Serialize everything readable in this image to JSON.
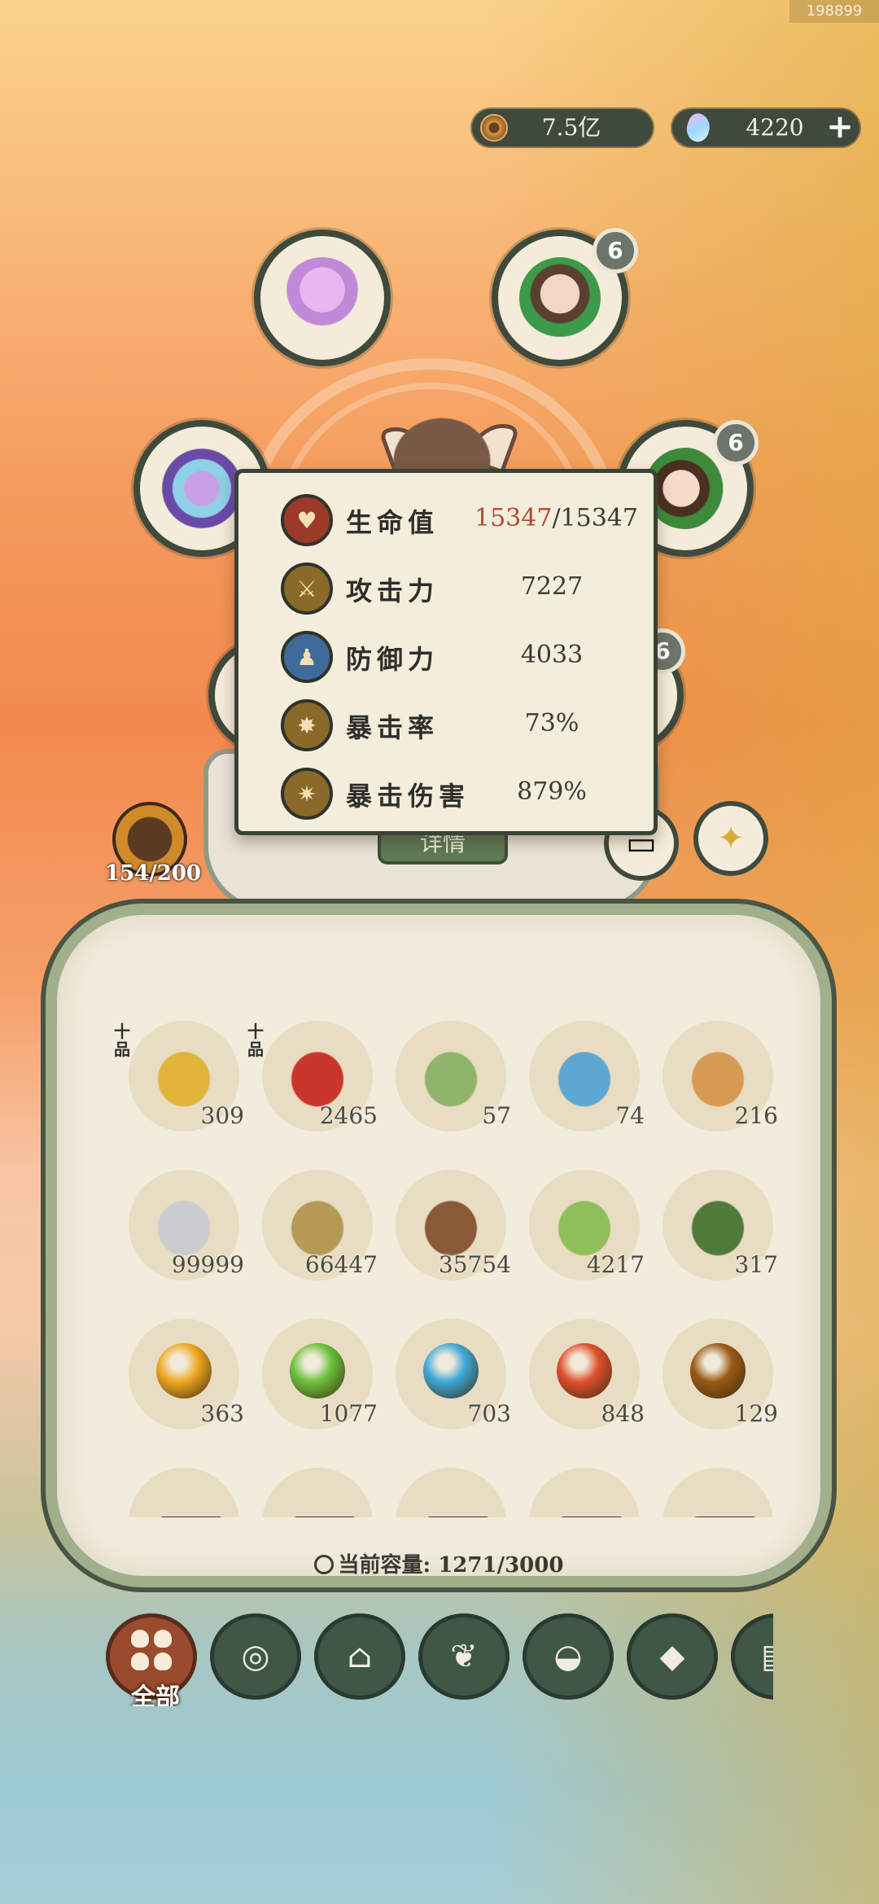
{
  "watermark": "198899",
  "currency": {
    "coin": {
      "icon": "copper-coin-icon",
      "value": "7.5亿"
    },
    "gem": {
      "icon": "crystal-gem-icon",
      "value": "4220",
      "plus": "+"
    }
  },
  "equipment_badges": {
    "top_right": "6",
    "mid_right": "6",
    "lower_right": "6"
  },
  "stats": [
    {
      "icon": "heart-icon",
      "name": "生命值",
      "current": "15347",
      "max": "/15347",
      "color": "#9c3a2a"
    },
    {
      "icon": "sword-icon",
      "name": "攻击力",
      "value": "7227",
      "color": "#8a6a2a"
    },
    {
      "icon": "shield-figure-icon",
      "name": "防御力",
      "value": "4033",
      "color": "#3f6b9a"
    },
    {
      "icon": "crit-burst-icon",
      "name": "暴击率",
      "value": "73%",
      "color": "#8a6a2a"
    },
    {
      "icon": "crit-damage-icon",
      "name": "暴击伤害",
      "value": "879%",
      "color": "#8a6a2a"
    }
  ],
  "detail_button": "详情",
  "side_count": "154/200",
  "inventory": {
    "grade_label": "十品",
    "items": [
      {
        "name": "golden-berries",
        "qty": "309",
        "grade": true,
        "color": "#e2b43a"
      },
      {
        "name": "red-berries",
        "qty": "2465",
        "grade": true,
        "color": "#c8362c"
      },
      {
        "name": "green-seed-pouch",
        "qty": "57",
        "color": "#8fb46a"
      },
      {
        "name": "blue-fish-pouch",
        "qty": "74",
        "color": "#5ea7d0"
      },
      {
        "name": "orange-pouch",
        "qty": "216",
        "color": "#d79a55"
      },
      {
        "name": "stone",
        "qty": "99999",
        "color": "#c9cdd0"
      },
      {
        "name": "straw",
        "qty": "66447",
        "color": "#b59a55"
      },
      {
        "name": "log",
        "qty": "35754",
        "color": "#8a5a36"
      },
      {
        "name": "bamboo",
        "qty": "4217",
        "color": "#8fbf5a"
      },
      {
        "name": "herb",
        "qty": "317",
        "color": "#4f7a3a"
      },
      {
        "name": "gold-orb",
        "qty": "363",
        "color": "#f0a820"
      },
      {
        "name": "green-orb",
        "qty": "1077",
        "color": "#6cc23a"
      },
      {
        "name": "blue-orb",
        "qty": "703",
        "color": "#3fa8d8"
      },
      {
        "name": "red-orb",
        "qty": "848",
        "color": "#e0502c"
      },
      {
        "name": "brown-orb",
        "qty": "129",
        "color": "#9a5a14"
      },
      {
        "name": "wood-plank",
        "qty": "",
        "color": "#d8b27a"
      },
      {
        "name": "bamboo-plank",
        "qty": "",
        "color": "#a9c46a"
      },
      {
        "name": "jade-ingot",
        "qty": "",
        "color": "#5f8c7a"
      },
      {
        "name": "iron-ingot",
        "qty": "",
        "color": "#6c7078"
      },
      {
        "name": "gold-ingot",
        "qty": "",
        "color": "#e8b82a"
      }
    ],
    "capacity_label": "当前容量:",
    "capacity_value": "1271/3000"
  },
  "tabs": [
    {
      "icon": "four-petal-icon",
      "label": "全部",
      "active": true
    },
    {
      "icon": "log-icon"
    },
    {
      "icon": "house-icon"
    },
    {
      "icon": "sprout-icon"
    },
    {
      "icon": "rice-bowl-icon"
    },
    {
      "icon": "mineral-icon"
    },
    {
      "icon": "scroll-icon"
    }
  ]
}
